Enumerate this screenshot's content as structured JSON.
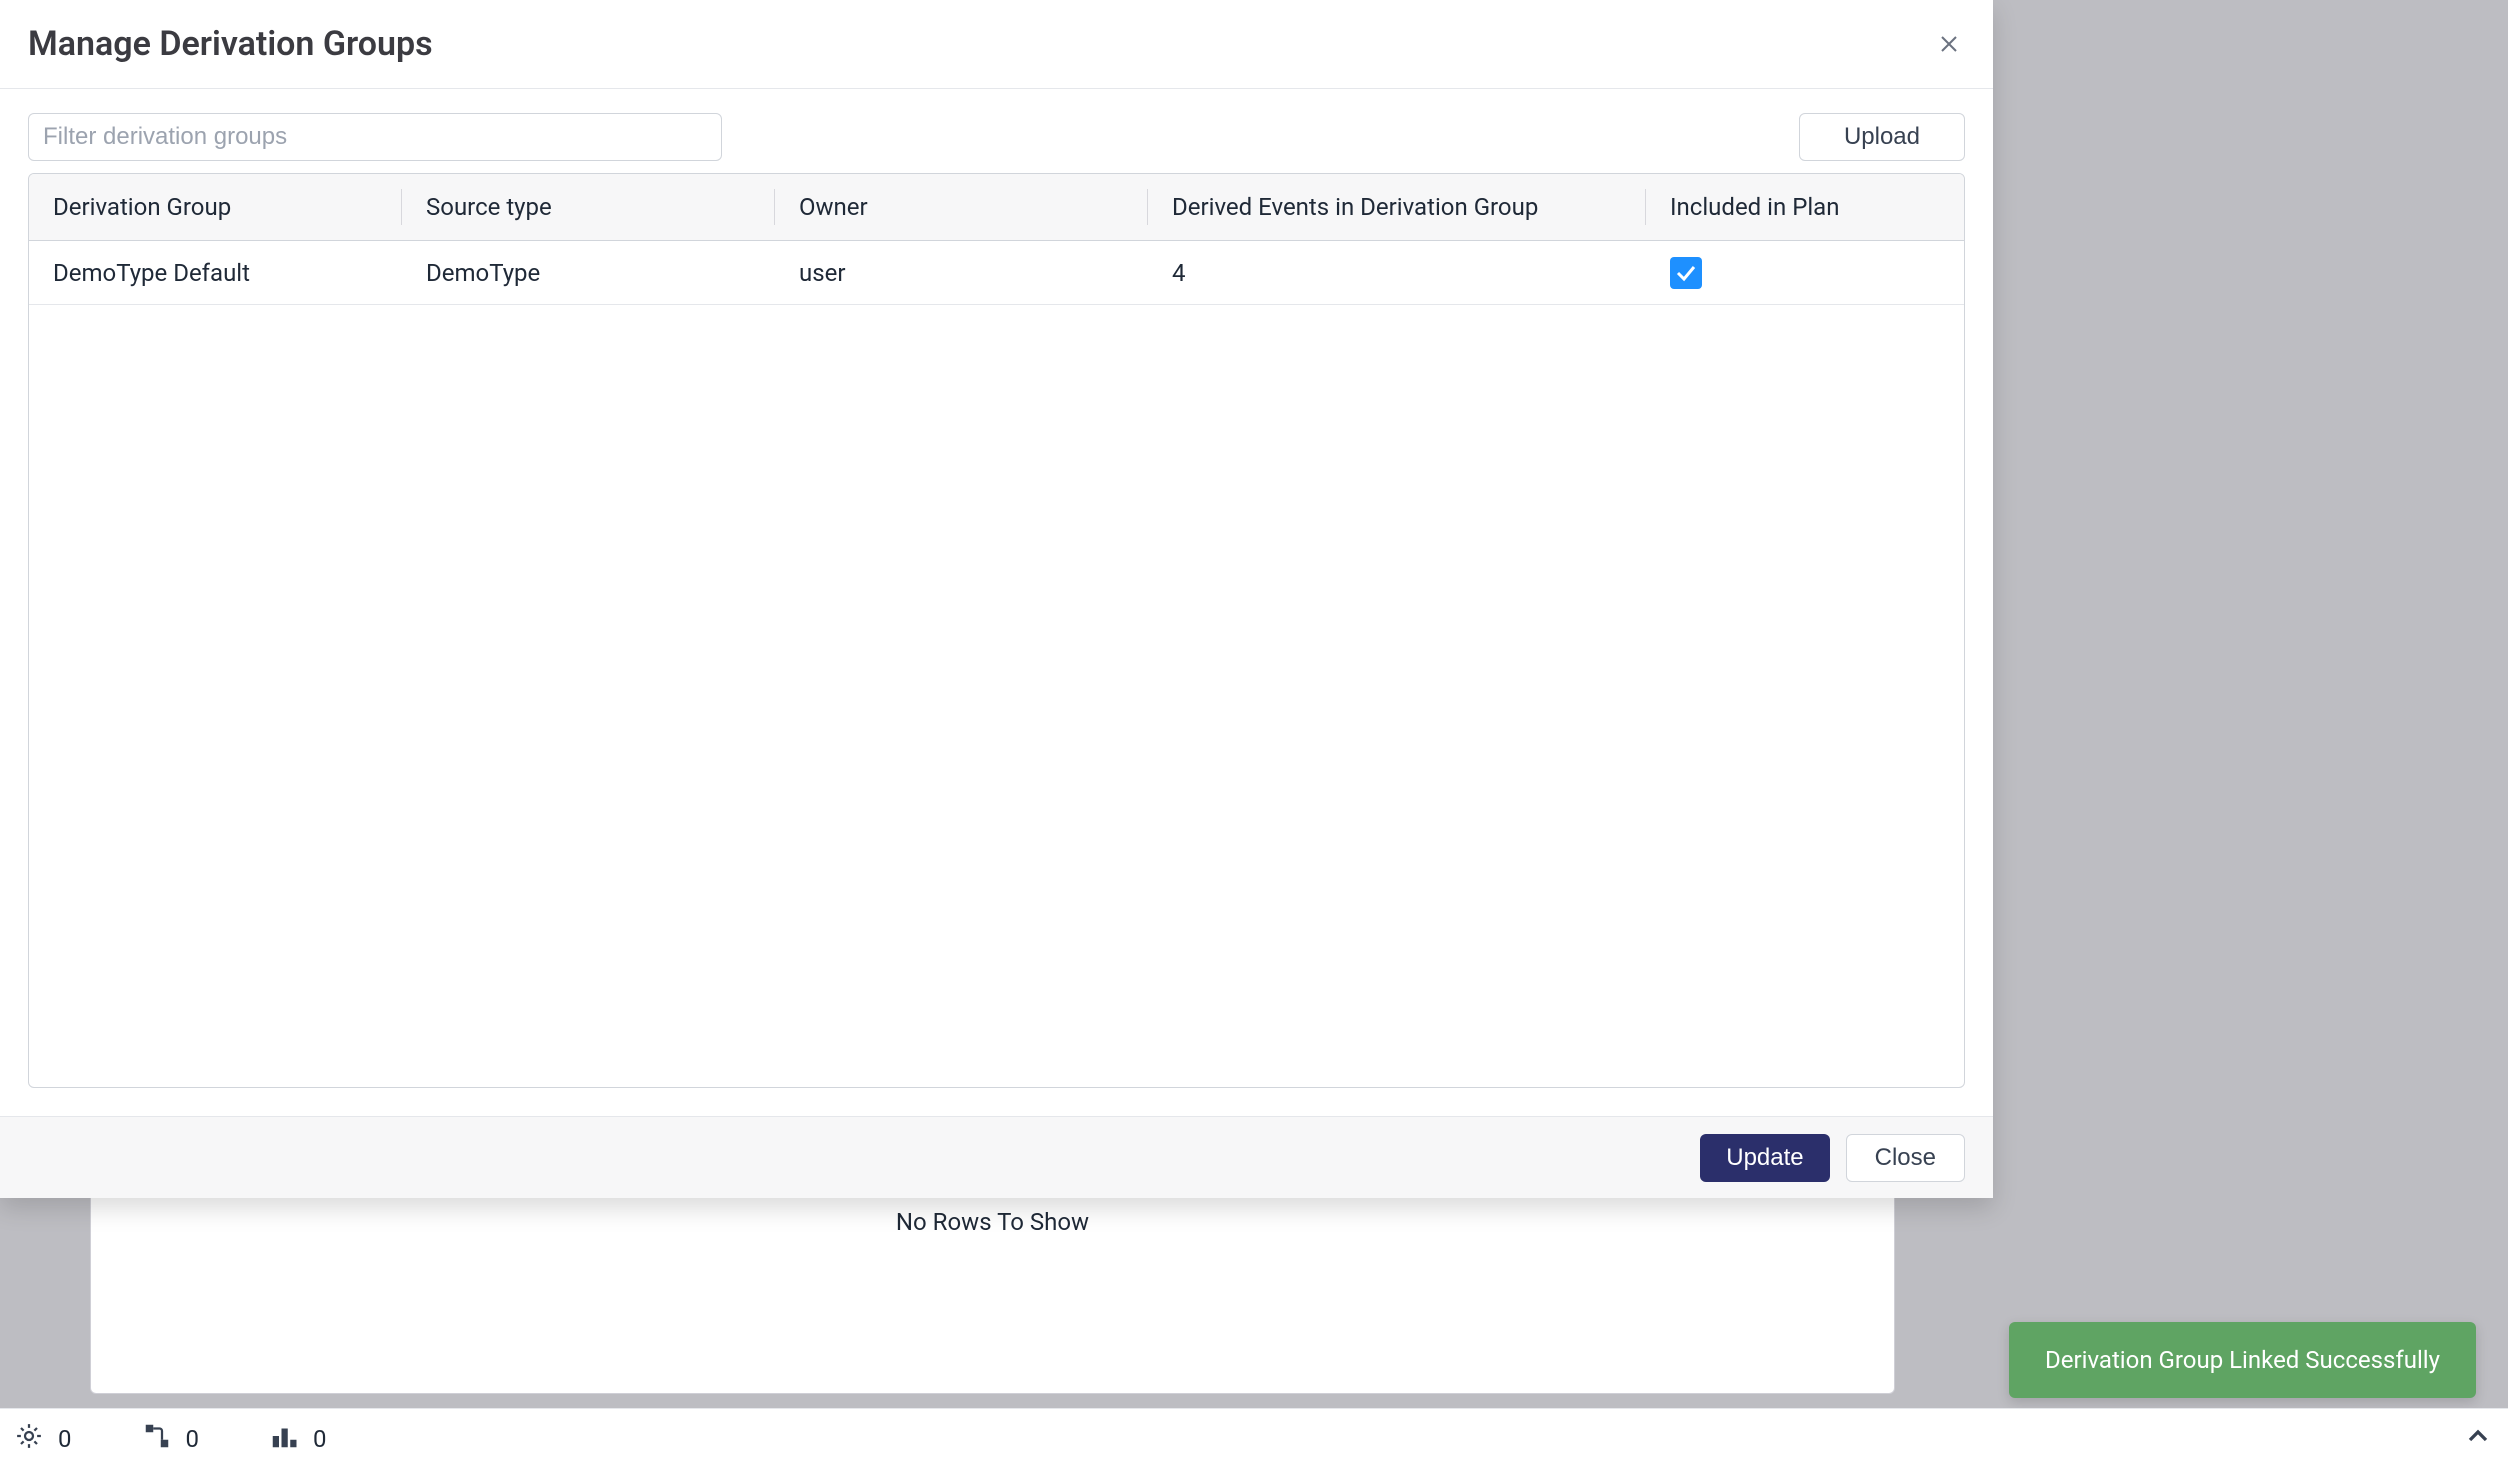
{
  "modal": {
    "title": "Manage Derivation Groups",
    "filter_placeholder": "Filter derivation groups",
    "upload_label": "Upload",
    "columns": {
      "c1": "Derivation Group",
      "c2": "Source type",
      "c3": "Owner",
      "c4": "Derived Events in Derivation Group",
      "c5": "Included in Plan"
    },
    "rows": [
      {
        "derivation_group": "DemoType Default",
        "source_type": "DemoType",
        "owner": "user",
        "derived_events": "4",
        "included": true
      }
    ],
    "footer": {
      "update": "Update",
      "close": "Close"
    }
  },
  "background": {
    "no_rows": "No Rows To Show"
  },
  "toast": {
    "message": "Derivation Group Linked Successfully"
  },
  "status_bar": {
    "gear_count": "0",
    "flow_count": "0",
    "chart_count": "0"
  }
}
